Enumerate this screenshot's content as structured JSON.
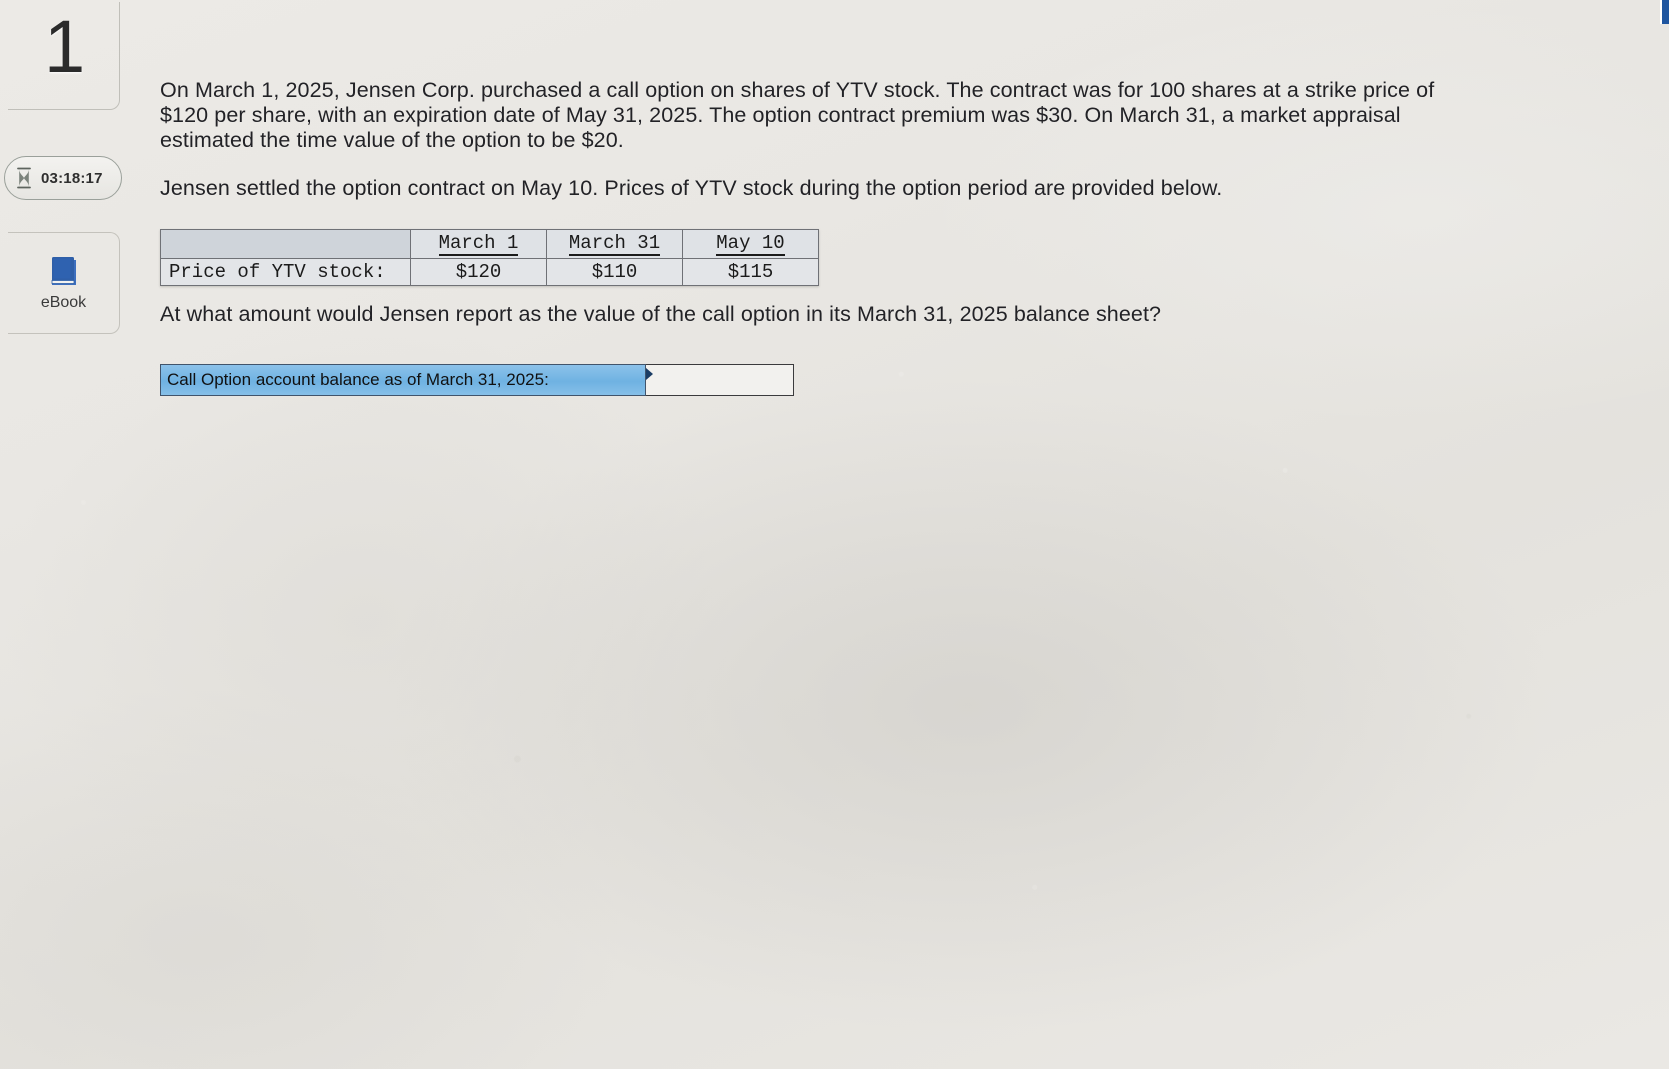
{
  "question": {
    "number": "1",
    "timer": "03:18:17",
    "timer_icon": "hourglass-icon",
    "ebook_label": "eBook",
    "ebook_icon": "book-icon"
  },
  "body": {
    "paragraph_1": "On March 1, 2025, Jensen Corp. purchased a call option on shares of YTV stock.  The contract was for 100 shares at a strike price of $120 per share, with an expiration date of May 31, 2025.  The option contract premium was $30.  On March 31, a market appraisal estimated the time value of the option to be $20.",
    "paragraph_2": "Jensen settled the option contract on May 10.  Prices of YTV stock during the option period are provided below.",
    "paragraph_3": "At what amount would Jensen report as the value of the call option in its March 31, 2025 balance sheet?"
  },
  "price_table": {
    "corner_header": "",
    "headers": [
      "March 1",
      "March 31",
      "May 10"
    ],
    "row_label": "Price of YTV stock:",
    "values": [
      "$120",
      "$110",
      "$115"
    ]
  },
  "answer": {
    "label": "Call Option account balance as of March 31, 2025:",
    "value": "",
    "placeholder": ""
  },
  "colors": {
    "answer_label_blue": "#6fb2e2",
    "table_header_gray": "#cfd4da",
    "edge_strip_blue": "#1f56a0"
  }
}
